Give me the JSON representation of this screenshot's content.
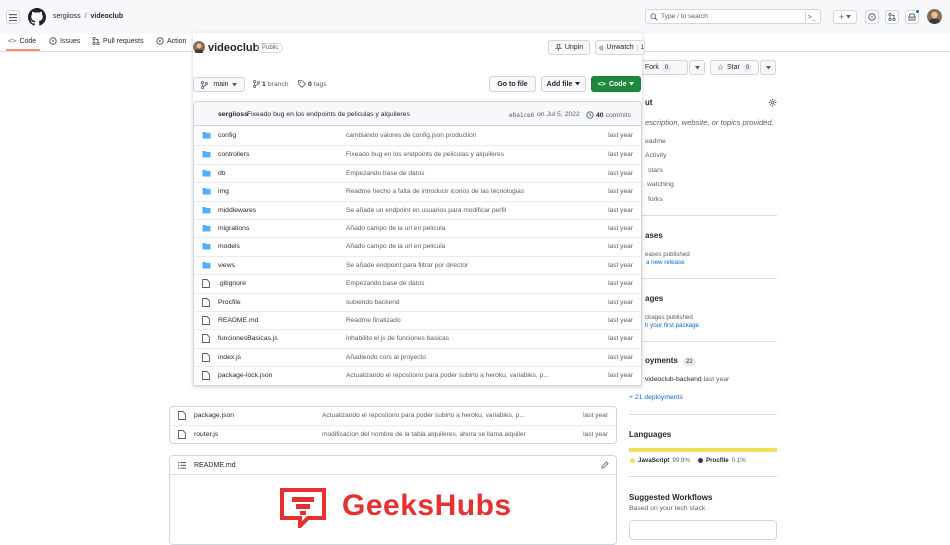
{
  "header": {
    "owner": "sergiioss",
    "separator": "/",
    "repo": "videoclub",
    "search_placeholder": "Type / to search"
  },
  "tabs": [
    {
      "label": "Code"
    },
    {
      "label": "Issues"
    },
    {
      "label": "Pull requests"
    },
    {
      "label": "Action"
    }
  ],
  "repo": {
    "name": "videoclub",
    "visibility": "Public",
    "unpin": "Unpin",
    "unwatch": "Unwatch",
    "watch_count": "1",
    "fork": "Fork",
    "fork_count": "0",
    "star": "Star",
    "star_count": "0"
  },
  "toolbar": {
    "branch": "main",
    "branches_count": "1",
    "branches_label": "branch",
    "tags_count": "0",
    "tags_label": "tags",
    "goto_file": "Go to file",
    "add_file": "Add file",
    "code": "Code"
  },
  "commit": {
    "author": "sergiioss",
    "message": "Fixeado bug en los endpoints de peliculas y alquileres",
    "hash": "eba1ce6",
    "date": "on Jul 5, 2022",
    "count": "40",
    "count_label": "commits"
  },
  "files": [
    {
      "name": "config",
      "message": "cambiando valores de config.json production",
      "time": "last year",
      "type": "dir"
    },
    {
      "name": "controllers",
      "message": "Fixeado bug en los endpoints de peliculas y alquileres",
      "time": "last year",
      "type": "dir"
    },
    {
      "name": "db",
      "message": "Empezando base de datos",
      "time": "last year",
      "type": "dir"
    },
    {
      "name": "img",
      "message": "Readme hecho a falta de introducir iconos de las tecnologias",
      "time": "last year",
      "type": "dir"
    },
    {
      "name": "middlewares",
      "message": "Se añade un endpoint en usuarios para modificar perfil",
      "time": "last year",
      "type": "dir"
    },
    {
      "name": "migrations",
      "message": "Añado campo de la url en pelicula",
      "time": "last year",
      "type": "dir"
    },
    {
      "name": "models",
      "message": "Añado campo de la url en pelicula",
      "time": "last year",
      "type": "dir"
    },
    {
      "name": "views",
      "message": "Se añade endpoint para filtrar por director",
      "time": "last year",
      "type": "dir"
    },
    {
      "name": ".gitignore",
      "message": "Empezando base de datos",
      "time": "last year",
      "type": "file"
    },
    {
      "name": "Procfile",
      "message": "subiendo backend",
      "time": "last year",
      "type": "file"
    },
    {
      "name": "README.md",
      "message": "Readme finalizado",
      "time": "last year",
      "type": "file"
    },
    {
      "name": "funcionesBasicas.js",
      "message": "inhabilito el js de funciones basicas",
      "time": "last year",
      "type": "file"
    },
    {
      "name": "index.js",
      "message": "Añadiendo cors al proyecto",
      "time": "last year",
      "type": "file"
    },
    {
      "name": "package-lock.json",
      "message": "Actualizando el repositorio para poder subirlo a heroku, variables, p...",
      "time": "last year",
      "type": "file"
    }
  ],
  "files_lower": [
    {
      "name": "package.json",
      "message": "Actualizando el repositorio para poder subirlo a heroku, variables, p...",
      "time": "last year"
    },
    {
      "name": "router.js",
      "message": "modificacion del nombre de la tabla alquileres, ahora se llama alquiler",
      "time": "last year"
    }
  ],
  "readme": {
    "title": "README.md",
    "logo_text": "GeeksHubs"
  },
  "sidebar": {
    "about": "ut",
    "description": "escription, website, or topics provided.",
    "readme": "eadme",
    "activity": "Activity",
    "stars": "stars",
    "watching": "watching",
    "forks": "forks",
    "releases_title": "ases",
    "releases_none": "eases published",
    "releases_link": "a new release",
    "packages_title": "ages",
    "packages_none": "ckages published",
    "packages_link": "h your first package",
    "deployments_title": "oyments",
    "deployments_count": "22",
    "deploy_env": "videoclub-backend",
    "deploy_time": "last year",
    "deploy_more": "+ 21 deployments",
    "languages_title": "Languages",
    "languages": [
      {
        "name": "JavaScript",
        "percent": "99.9%",
        "value": 99.9,
        "color": "#f1e05a"
      },
      {
        "name": "Procfile",
        "percent": "0.1%",
        "value": 0.1,
        "color": "#3b2f63"
      }
    ],
    "workflows_title": "Suggested Workflows",
    "workflows_sub": "Based on your tech stack"
  }
}
